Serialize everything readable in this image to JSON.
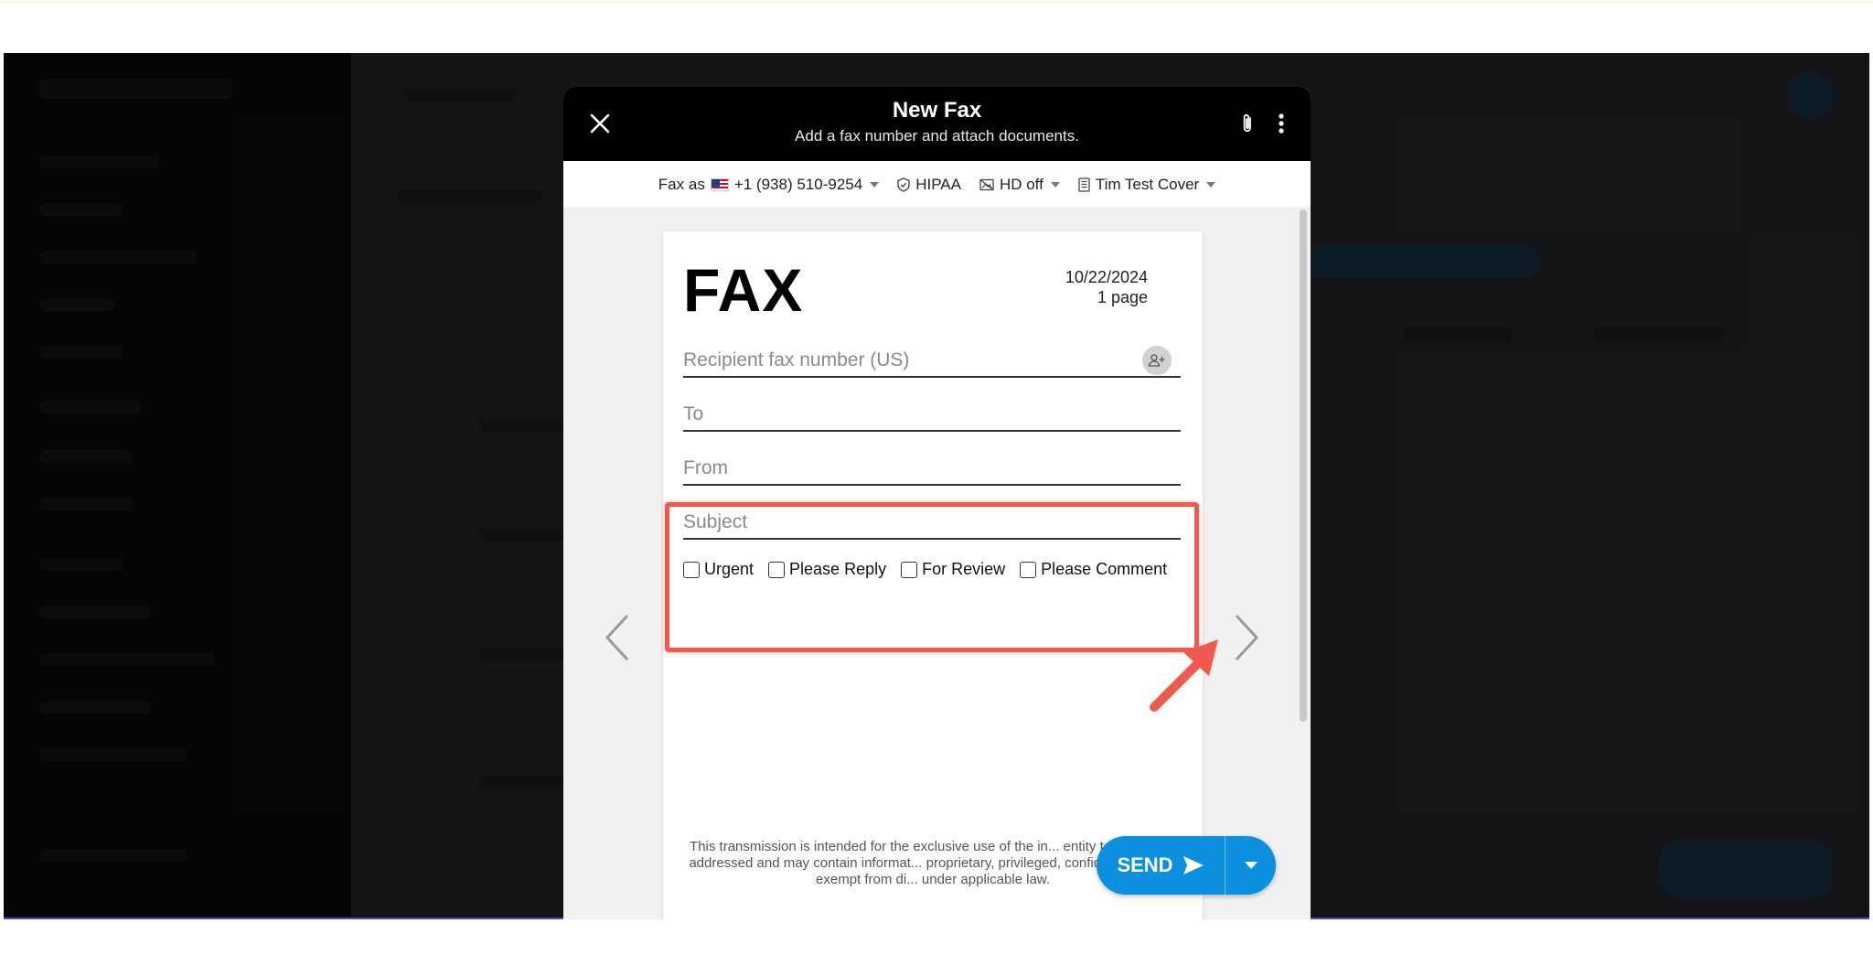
{
  "modal": {
    "title": "New Fax",
    "subtitle": "Add a fax number and attach documents."
  },
  "toolbar": {
    "fax_as_label": "Fax as",
    "fax_number": "+1 (938) 510-9254",
    "hipaa_label": "HIPAA",
    "hd_label": "HD off",
    "cover_label": "Tim Test Cover"
  },
  "page": {
    "heading": "FAX",
    "date": "10/22/2024",
    "pages": "1 page",
    "recipient_placeholder": "Recipient fax number (US)",
    "to_placeholder": "To",
    "from_placeholder": "From",
    "subject_placeholder": "Subject",
    "checkboxes": [
      {
        "label": "Urgent",
        "checked": false
      },
      {
        "label": "Please Reply",
        "checked": false
      },
      {
        "label": "For Review",
        "checked": false
      },
      {
        "label": "Please Comment",
        "checked": false
      }
    ],
    "disclaimer": "This transmission is intended for the exclusive use of the in... entity to whom it is addressed and may contain informat... proprietary, privileged, confidential and/or exempt from di... under applicable law."
  },
  "send": {
    "label": "SEND"
  },
  "colors": {
    "accent": "#0d8fe0",
    "highlight": "#ef5a4c",
    "header_bg": "#000000"
  },
  "icons": {
    "close": "close-icon",
    "attach": "paperclip-icon",
    "more": "more-vertical-icon",
    "hipaa": "shield-icon",
    "hd": "image-icon",
    "cover": "document-icon",
    "contact": "add-contact-icon",
    "send": "send-icon",
    "prev": "chevron-left-icon",
    "next": "chevron-right-icon"
  }
}
